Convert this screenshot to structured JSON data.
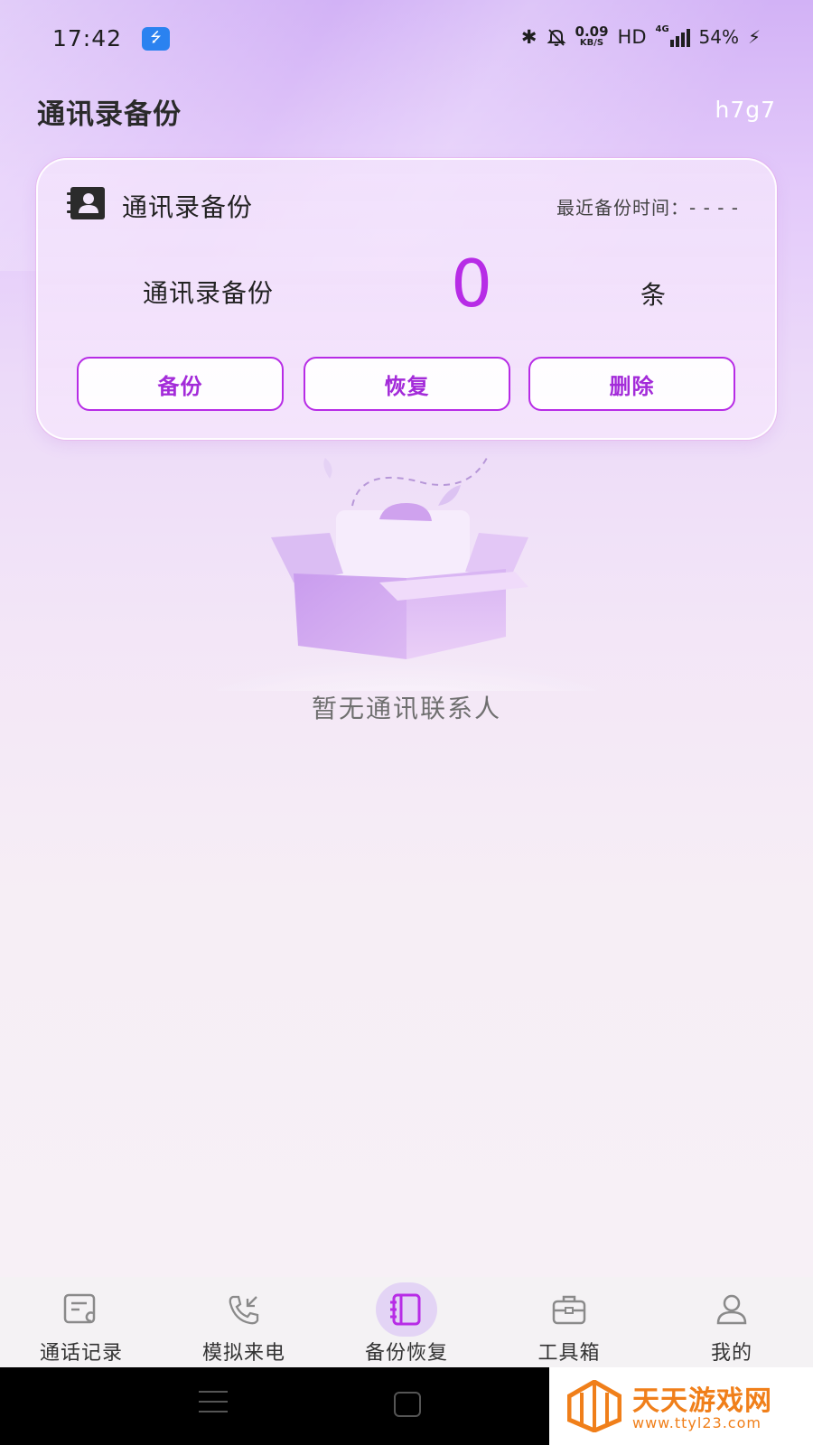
{
  "status_bar": {
    "time": "17:42",
    "usb_icon": "usb-icon",
    "net_speed_value": "0.09",
    "net_speed_unit": "KB/S",
    "hd": "HD",
    "network_type": "4G",
    "battery": "54%"
  },
  "header": {
    "title": "通讯录备份",
    "code": "h7g7"
  },
  "backup_card": {
    "title": "通讯录备份",
    "last_backup_time": "最近备份时间：- - - -",
    "count_label": "通讯录备份",
    "count": "0",
    "count_unit": "条",
    "buttons": {
      "backup": "备份",
      "restore": "恢复",
      "delete": "删除"
    }
  },
  "empty_state": {
    "message": "暂无通讯联系人"
  },
  "bottom_nav": {
    "items": [
      {
        "label": "通话记录",
        "icon": "call-log-icon"
      },
      {
        "label": "模拟来电",
        "icon": "incoming-call-icon"
      },
      {
        "label": "备份恢复",
        "icon": "notebook-icon",
        "active": true
      },
      {
        "label": "工具箱",
        "icon": "toolbox-icon"
      },
      {
        "label": "我的",
        "icon": "user-icon"
      }
    ]
  },
  "watermark": {
    "name": "天天游戏网",
    "url": "www.ttyl23.com"
  },
  "colors": {
    "accent": "#b72ce6",
    "watermark": "#f07f1a"
  }
}
